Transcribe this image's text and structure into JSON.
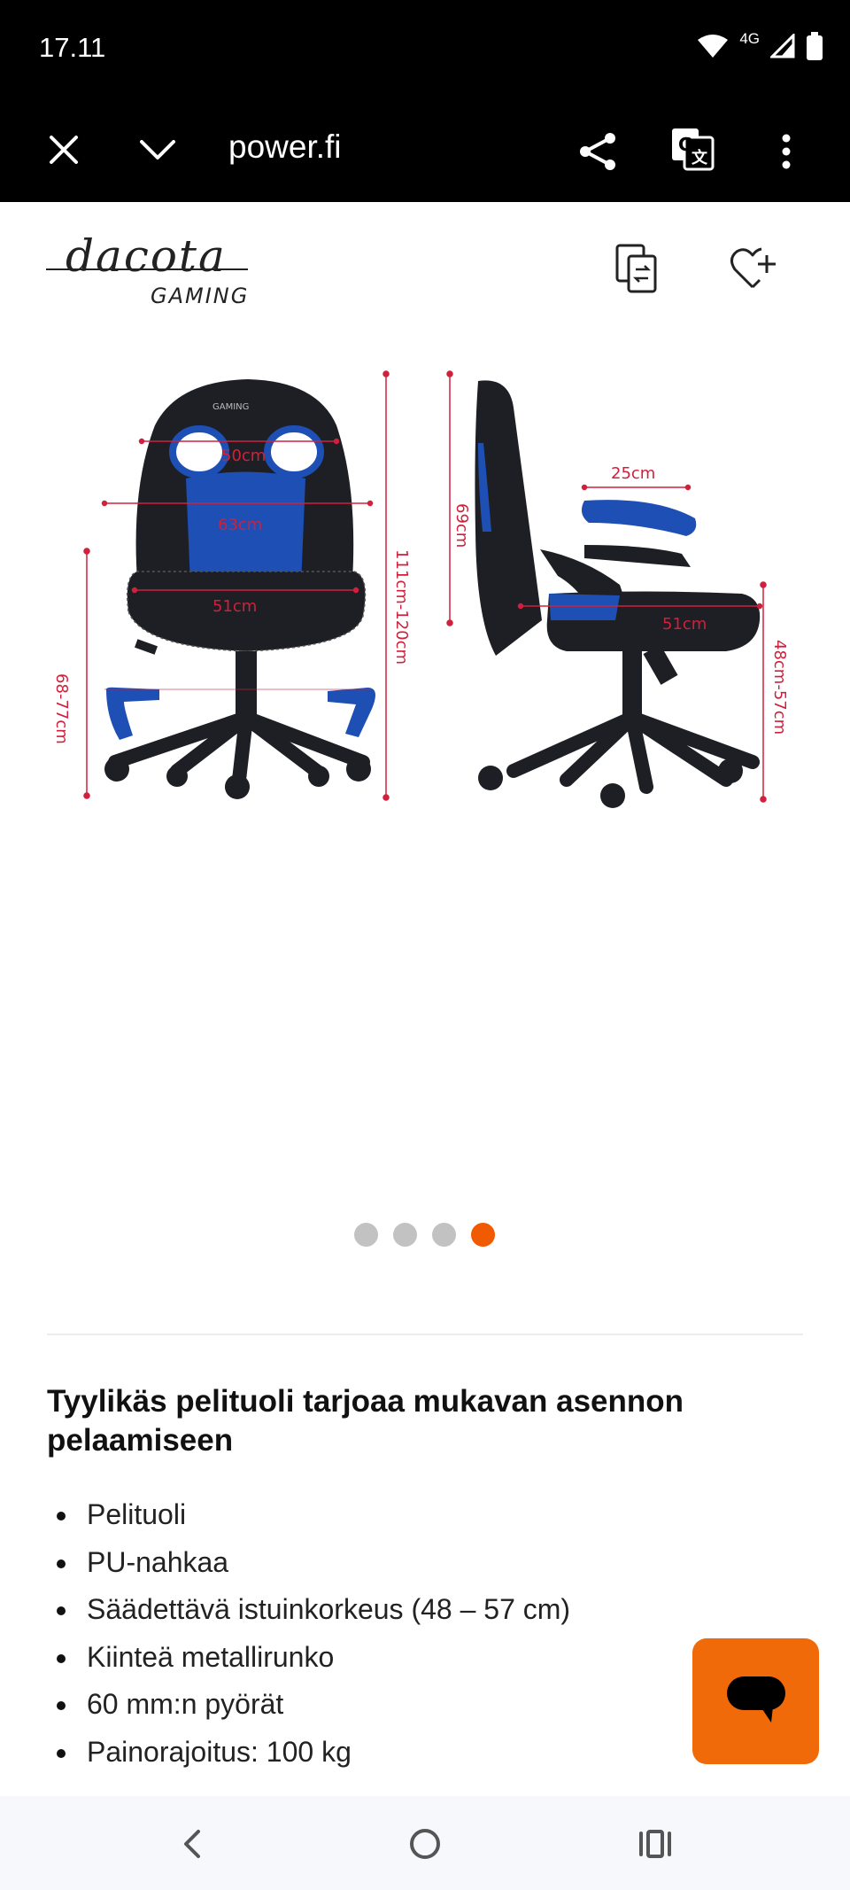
{
  "status_bar": {
    "time": "17.11",
    "network": "4G",
    "icons": [
      "wifi-icon",
      "signal-icon",
      "battery-icon"
    ]
  },
  "browser": {
    "url": "power.fi",
    "icons": [
      "close-icon",
      "chevron-down-icon",
      "share-icon",
      "translate-icon",
      "more-icon"
    ]
  },
  "header": {
    "brand_line1": "dacota",
    "brand_line2": "GAMING",
    "icons": [
      "compare-icon",
      "wishlist-add-icon"
    ]
  },
  "product_image": {
    "front_labels": [
      "50cm",
      "63cm",
      "51cm",
      "68-77cm",
      "111cm-120cm"
    ],
    "side_labels": [
      "69cm",
      "25cm",
      "51cm",
      "48cm-57cm"
    ],
    "chair_logo_text": "GAMING"
  },
  "carousel": {
    "total": 4,
    "active_index": 3
  },
  "description": {
    "heading": "Tyylikäs pelituoli tarjoaa mukavan asennon pelaamiseen",
    "features": [
      "Pelituoli",
      "PU-nahkaa",
      "Säädettävä istuinkorkeus (48 – 57 cm)",
      "Kiinteä metallirunko",
      "60 mm:n pyörät",
      "Painorajoitus: 100 kg"
    ]
  },
  "chat": {
    "icon": "chat-icon"
  },
  "nav": {
    "icons": [
      "back-icon",
      "home-icon",
      "recents-icon"
    ]
  },
  "colors": {
    "accent": "#f06a0a",
    "dimension_red": "#d0203c",
    "chair_blue": "#1d4fb5",
    "chair_black": "#1e1f24"
  }
}
